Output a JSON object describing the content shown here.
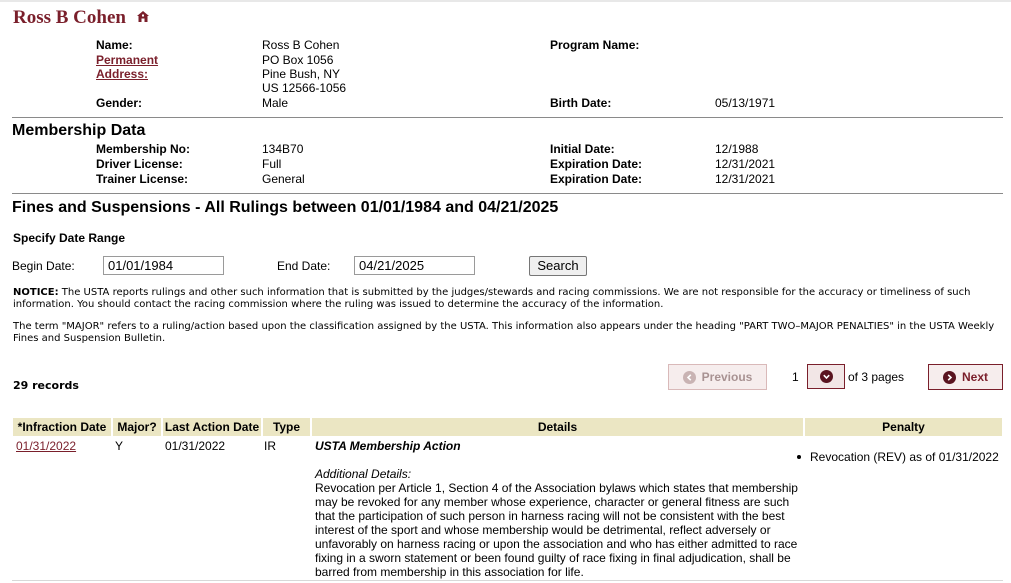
{
  "header": {
    "name_title": "Ross B Cohen"
  },
  "person": {
    "name_label": "Name:",
    "name_value": "Ross B Cohen",
    "address_label_line1": "Permanent",
    "address_label_line2": "Address:",
    "address_lines": [
      "PO Box 1056",
      "Pine Bush, NY",
      "US 12566-1056"
    ],
    "program_name_label": "Program Name:",
    "program_name_value": "",
    "gender_label": "Gender:",
    "gender_value": "Male",
    "birth_date_label": "Birth Date:",
    "birth_date_value": "05/13/1971"
  },
  "membership": {
    "section_title": "Membership Data",
    "membership_no_label": "Membership No:",
    "membership_no_value": "134B70",
    "initial_date_label": "Initial Date:",
    "initial_date_value": "12/1988",
    "driver_license_label": "Driver License:",
    "driver_license_value": "Full",
    "driver_exp_label": "Expiration Date:",
    "driver_exp_value": "12/31/2021",
    "trainer_license_label": "Trainer License:",
    "trainer_license_value": "General",
    "trainer_exp_label": "Expiration Date:",
    "trainer_exp_value": "12/31/2021"
  },
  "fines": {
    "section_title": "Fines and Suspensions - All Rulings between 01/01/1984 and 04/21/2025",
    "specify_label": "Specify Date Range",
    "begin_label": "Begin Date:",
    "begin_value": "01/01/1984",
    "end_label": "End Date:",
    "end_value": "04/21/2025",
    "search_label": "Search",
    "notice_bold": "NOTICE:",
    "notice_text": " The USTA reports rulings and other such information that is submitted by the judges/stewards and racing commissions. We are not responsible for the accuracy or timeliness of such information. You should contact the racing commission where the ruling was issued to determine the accuracy of the information.",
    "major_text": "The term \"MAJOR\" refers to a ruling/action based upon the classification assigned by the USTA. This information also appears under the heading \"PART TWO–MAJOR PENALTIES\" in the USTA Weekly Fines and Suspension Bulletin."
  },
  "pagination": {
    "records": "29 records",
    "previous_label": "Previous",
    "current_page": "1",
    "pages_text": "of 3 pages",
    "next_label": "Next"
  },
  "table": {
    "headers": [
      "*Infraction Date",
      "Major?",
      "Last Action Date",
      "Type",
      "Details",
      "Penalty"
    ],
    "rows": [
      {
        "infraction_date": "01/31/2022",
        "major": "Y",
        "last_action_date": "01/31/2022",
        "type": "IR",
        "details_title": "USTA Membership Action",
        "additional_label": "Additional Details:",
        "details_text": "Revocation per Article 1, Section 4 of the Association bylaws which states that membership may be revoked for any member whose experience, character or general fitness are such that the participation of such person in harness racing will not be consistent with the best interest of the sport and whose membership would be detrimental, reflect adversely or unfavorably on harness racing or upon the association and who has either admitted to race fixing in a sworn statement or been found guilty of race fixing in final adjudication, shall be barred from membership in this association for life.",
        "penalty": "Revocation (REV) as of 01/31/2022"
      }
    ]
  },
  "colors": {
    "accent": "#7a1f2b",
    "table_header_bg": "#ebe6c3"
  },
  "icons": {
    "title_icon": "home-icon",
    "prev_icon": "chevron-left-icon",
    "next_icon": "chevron-right-icon",
    "dropdown_icon": "chevron-down-icon"
  }
}
